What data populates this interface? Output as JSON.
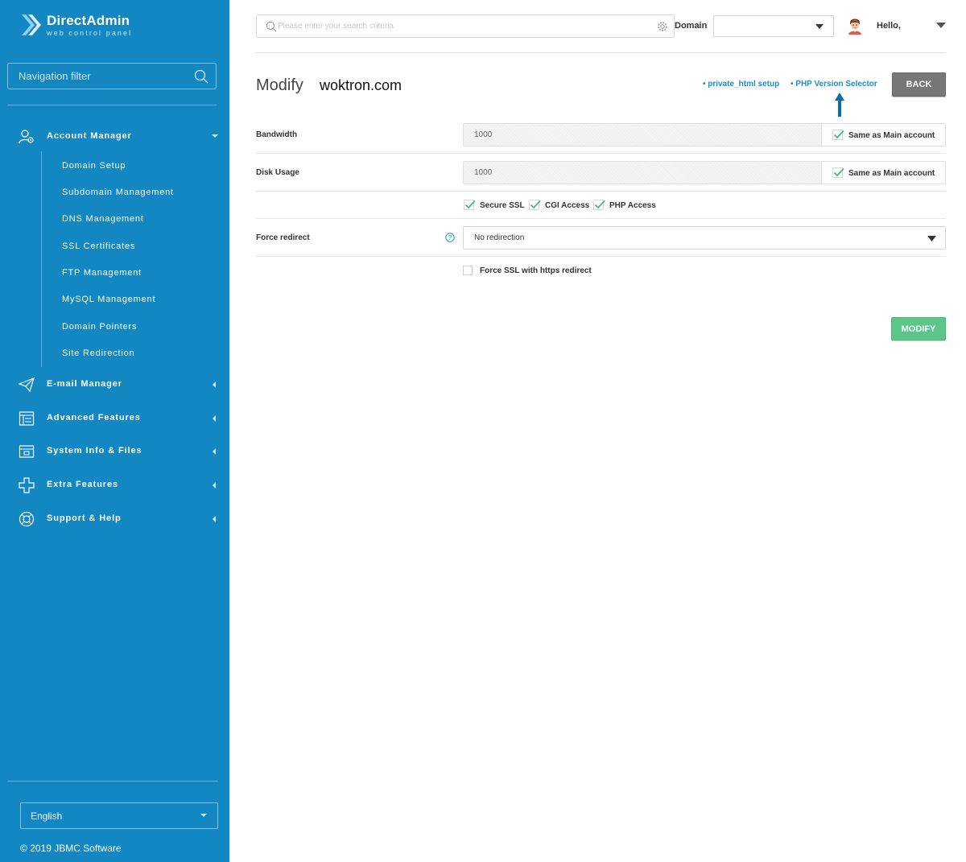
{
  "sidebar": {
    "logo_title": "DirectAdmin",
    "logo_subtitle": "web control panel",
    "nav_filter_placeholder": "Navigation filter",
    "menus": [
      {
        "label": "Account Manager",
        "icon": "account-manager-icon",
        "expanded": true
      },
      {
        "label": "E-mail Manager",
        "icon": "paper-plane-icon",
        "expanded": false
      },
      {
        "label": "Advanced Features",
        "icon": "list-icon",
        "expanded": false
      },
      {
        "label": "System Info & Files",
        "icon": "folder-icon",
        "expanded": false
      },
      {
        "label": "Extra Features",
        "icon": "plus-icon",
        "expanded": false
      },
      {
        "label": "Support & Help",
        "icon": "lifebuoy-icon",
        "expanded": false
      }
    ],
    "account_manager_items": [
      "Domain Setup",
      "Subdomain Management",
      "DNS Management",
      "SSL Certificates",
      "FTP Management",
      "MySQL Management",
      "Domain Pointers",
      "Site Redirection"
    ],
    "language": "English",
    "copyright": "© 2019 JBMC Software"
  },
  "topbar": {
    "search_placeholder": "Please enter your search criteria",
    "domain_label": "Domain",
    "domain_value": "",
    "greeting": "Hello,"
  },
  "page": {
    "title": "Modify",
    "domain": "woktron.com",
    "links": {
      "private_html": "• private_html setup",
      "php_selector": "• PHP Version Selector"
    },
    "back_label": "BACK",
    "modify_label": "MODIFY"
  },
  "form": {
    "bandwidth": {
      "label": "Bandwidth",
      "value": "1000",
      "same_label": "Same as Main account",
      "same_checked": true
    },
    "disk": {
      "label": "Disk Usage",
      "value": "1000",
      "same_label": "Same as Main account",
      "same_checked": true
    },
    "options": [
      {
        "label": "Secure SSL",
        "checked": true
      },
      {
        "label": "CGI Access",
        "checked": true
      },
      {
        "label": "PHP Access",
        "checked": true
      }
    ],
    "force_redirect": {
      "label": "Force redirect",
      "value": "No redirection"
    },
    "force_ssl": {
      "label": "Force SSL with https redirect",
      "checked": false
    }
  },
  "colors": {
    "sidebar_bg": "#1287c2",
    "link": "#1c8fc9",
    "check": "#3dbb7a",
    "modify_button": "#5cc68a",
    "back_button": "#777777",
    "arrow_annotation": "#0b6fa4"
  }
}
